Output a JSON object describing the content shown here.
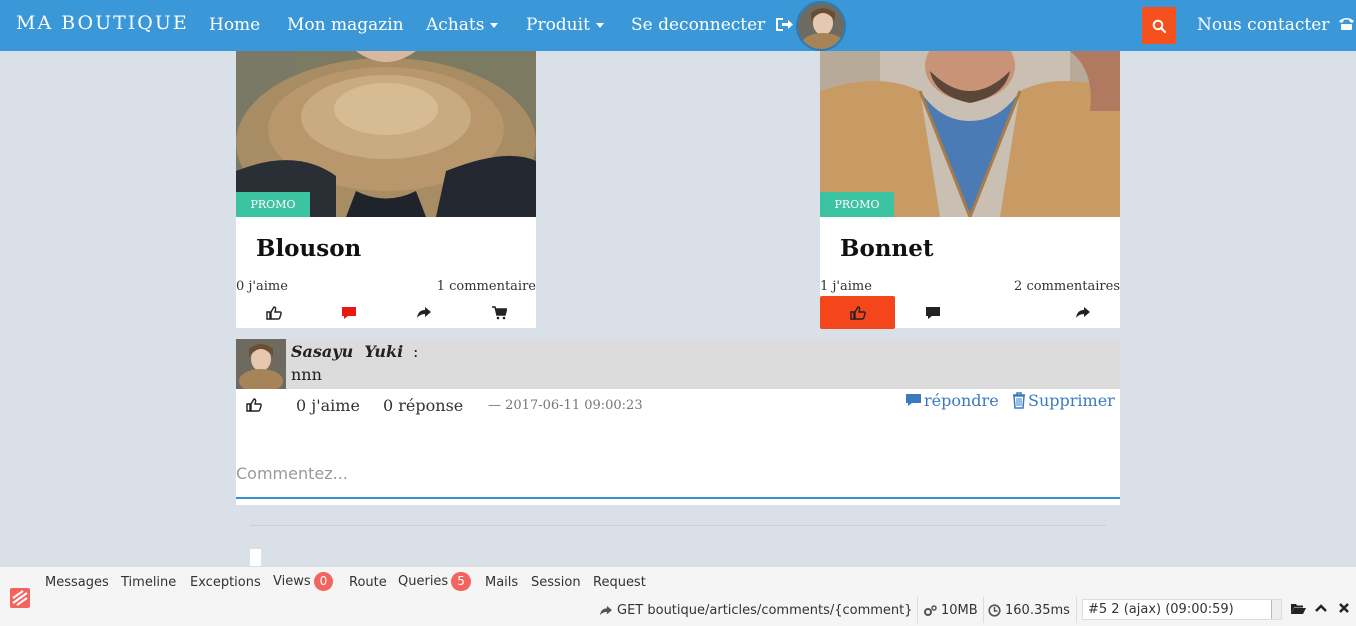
{
  "navbar": {
    "brand": "MA BOUTIQUE",
    "items": [
      {
        "label": "Home"
      },
      {
        "label": "Mon magazin"
      },
      {
        "label": "Achats"
      },
      {
        "label": "Produit"
      },
      {
        "label": "Se deconnecter"
      }
    ],
    "contact_label": "Nous contacter",
    "color": "#3a97d8",
    "search_color": "#f4511e"
  },
  "cards": [
    {
      "title": "Blouson",
      "badge": "PROMO",
      "likes": "0 j'aime",
      "comments": "1 commentaire"
    },
    {
      "title": "Bonnet",
      "badge": "PROMO",
      "likes": "1 j'aime",
      "comments": "2 commentaires"
    }
  ],
  "comment": {
    "author": "Sasayu  Yuki",
    "colon": ":",
    "text": "nnn",
    "likes": "0 j'aime",
    "replies": "0 réponse",
    "date": "— 2017-06-11 09:00:23",
    "reply_label": "répondre",
    "delete_label": "Supprimer",
    "input_placeholder": "Commentez..."
  },
  "debugbar": {
    "tabs": [
      {
        "label": "Messages"
      },
      {
        "label": "Timeline"
      },
      {
        "label": "Exceptions"
      },
      {
        "label": "Views",
        "badge": "0"
      },
      {
        "label": "Route"
      },
      {
        "label": "Queries",
        "badge": "5"
      },
      {
        "label": "Mails"
      },
      {
        "label": "Session"
      },
      {
        "label": "Request"
      }
    ],
    "route": "GET boutique/articles/comments/{comment}",
    "memory": "10MB",
    "time": "160.35ms",
    "request_select": "#5 2 (ajax) (09:00:59)"
  }
}
